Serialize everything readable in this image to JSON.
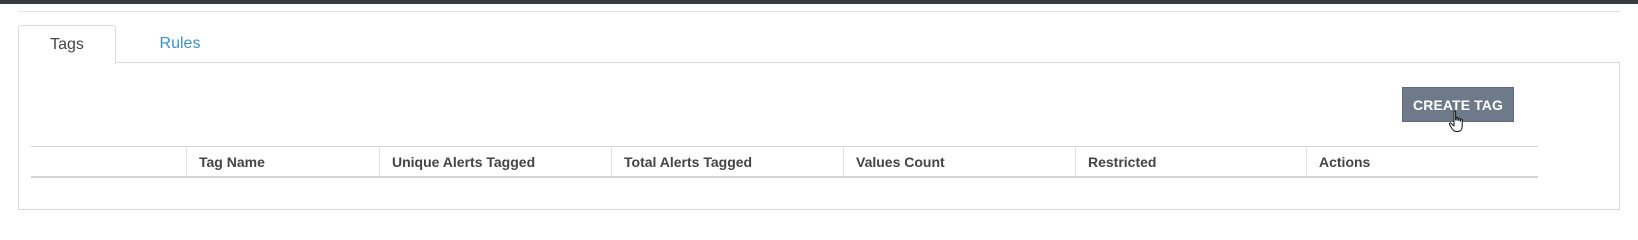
{
  "tabs": [
    {
      "label": "Tags",
      "active": true
    },
    {
      "label": "Rules",
      "active": false
    }
  ],
  "toolbar": {
    "create_label": "CREATE TAG"
  },
  "table": {
    "columns": [
      "",
      "Tag Name",
      "Unique Alerts Tagged",
      "Total Alerts Tagged",
      "Values Count",
      "Restricted",
      "Actions"
    ],
    "rows": []
  },
  "colors": {
    "accent_link": "#3d8fc4",
    "button_bg": "#6e7a89",
    "top_bar": "#3a3b3f"
  },
  "cursor": {
    "icon": "hand-pointer-icon"
  }
}
